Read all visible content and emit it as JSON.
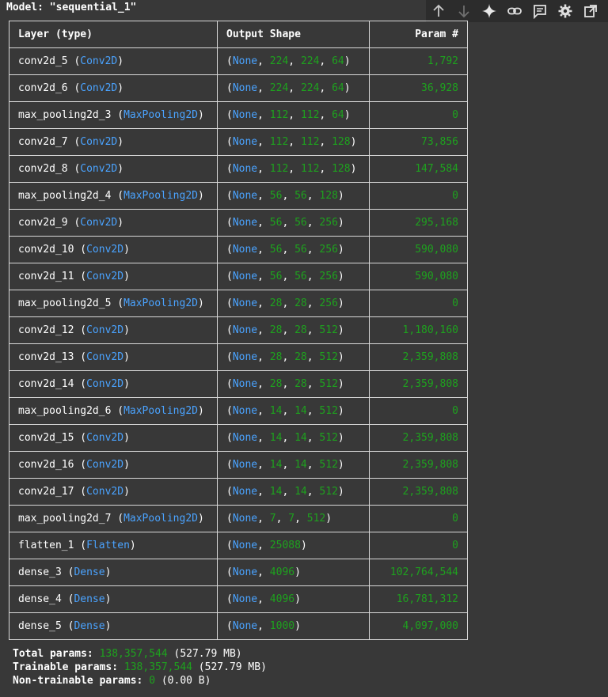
{
  "title": "Model: \"sequential_1\"",
  "toolbar": [
    {
      "name": "move-up-icon"
    },
    {
      "name": "move-down-icon"
    },
    {
      "name": "sparkle-icon"
    },
    {
      "name": "link-icon"
    },
    {
      "name": "comment-icon"
    },
    {
      "name": "gear-icon"
    },
    {
      "name": "open-external-icon"
    }
  ],
  "headers": {
    "layer": "Layer (type)",
    "output": "Output Shape",
    "params": "Param #"
  },
  "rows": [
    {
      "name": "conv2d_5",
      "type": "Conv2D",
      "shape": [
        "None",
        "224",
        "224",
        "64"
      ],
      "params": "1,792"
    },
    {
      "name": "conv2d_6",
      "type": "Conv2D",
      "shape": [
        "None",
        "224",
        "224",
        "64"
      ],
      "params": "36,928"
    },
    {
      "name": "max_pooling2d_3",
      "type": "MaxPooling2D",
      "shape": [
        "None",
        "112",
        "112",
        "64"
      ],
      "params": "0"
    },
    {
      "name": "conv2d_7",
      "type": "Conv2D",
      "shape": [
        "None",
        "112",
        "112",
        "128"
      ],
      "params": "73,856"
    },
    {
      "name": "conv2d_8",
      "type": "Conv2D",
      "shape": [
        "None",
        "112",
        "112",
        "128"
      ],
      "params": "147,584"
    },
    {
      "name": "max_pooling2d_4",
      "type": "MaxPooling2D",
      "shape": [
        "None",
        "56",
        "56",
        "128"
      ],
      "params": "0"
    },
    {
      "name": "conv2d_9",
      "type": "Conv2D",
      "shape": [
        "None",
        "56",
        "56",
        "256"
      ],
      "params": "295,168"
    },
    {
      "name": "conv2d_10",
      "type": "Conv2D",
      "shape": [
        "None",
        "56",
        "56",
        "256"
      ],
      "params": "590,080"
    },
    {
      "name": "conv2d_11",
      "type": "Conv2D",
      "shape": [
        "None",
        "56",
        "56",
        "256"
      ],
      "params": "590,080"
    },
    {
      "name": "max_pooling2d_5",
      "type": "MaxPooling2D",
      "shape": [
        "None",
        "28",
        "28",
        "256"
      ],
      "params": "0"
    },
    {
      "name": "conv2d_12",
      "type": "Conv2D",
      "shape": [
        "None",
        "28",
        "28",
        "512"
      ],
      "params": "1,180,160"
    },
    {
      "name": "conv2d_13",
      "type": "Conv2D",
      "shape": [
        "None",
        "28",
        "28",
        "512"
      ],
      "params": "2,359,808"
    },
    {
      "name": "conv2d_14",
      "type": "Conv2D",
      "shape": [
        "None",
        "28",
        "28",
        "512"
      ],
      "params": "2,359,808"
    },
    {
      "name": "max_pooling2d_6",
      "type": "MaxPooling2D",
      "shape": [
        "None",
        "14",
        "14",
        "512"
      ],
      "params": "0"
    },
    {
      "name": "conv2d_15",
      "type": "Conv2D",
      "shape": [
        "None",
        "14",
        "14",
        "512"
      ],
      "params": "2,359,808"
    },
    {
      "name": "conv2d_16",
      "type": "Conv2D",
      "shape": [
        "None",
        "14",
        "14",
        "512"
      ],
      "params": "2,359,808"
    },
    {
      "name": "conv2d_17",
      "type": "Conv2D",
      "shape": [
        "None",
        "14",
        "14",
        "512"
      ],
      "params": "2,359,808"
    },
    {
      "name": "max_pooling2d_7",
      "type": "MaxPooling2D",
      "shape": [
        "None",
        "7",
        "7",
        "512"
      ],
      "params": "0"
    },
    {
      "name": "flatten_1",
      "type": "Flatten",
      "shape": [
        "None",
        "25088"
      ],
      "params": "0"
    },
    {
      "name": "dense_3",
      "type": "Dense",
      "shape": [
        "None",
        "4096"
      ],
      "params": "102,764,544"
    },
    {
      "name": "dense_4",
      "type": "Dense",
      "shape": [
        "None",
        "4096"
      ],
      "params": "16,781,312"
    },
    {
      "name": "dense_5",
      "type": "Dense",
      "shape": [
        "None",
        "1000"
      ],
      "params": "4,097,000"
    }
  ],
  "summary": {
    "total_label": "Total params: ",
    "total_value": "138,357,544",
    "total_size": " (527.79 MB)",
    "trainable_label": "Trainable params: ",
    "trainable_value": "138,357,544",
    "trainable_size": " (527.79 MB)",
    "nontrainable_label": "Non-trainable params: ",
    "nontrainable_value": "0",
    "nontrainable_size": " (0.00 B)"
  },
  "colors": {
    "background": "#383838",
    "type_blue": "#4aa3ff",
    "number_green": "#1ea21e",
    "border": "#d9d9d9"
  }
}
